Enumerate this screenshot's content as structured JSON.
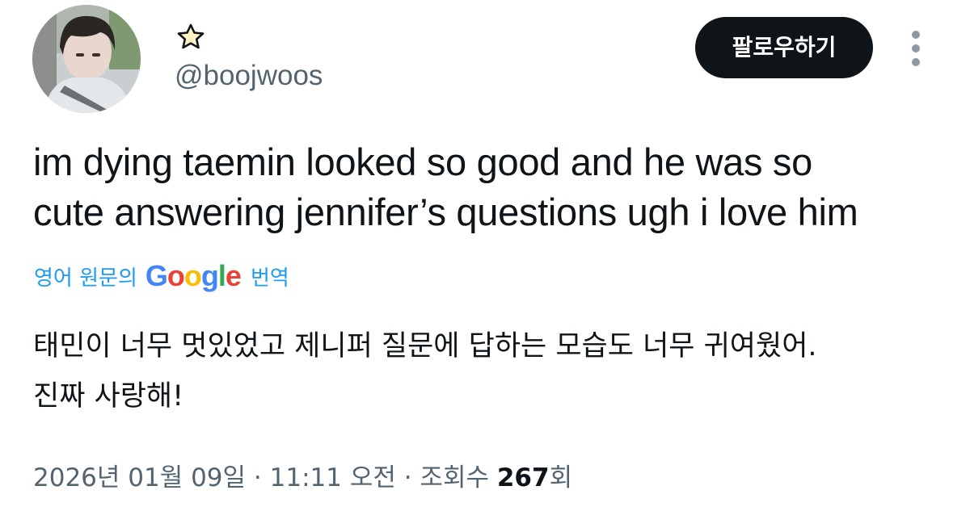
{
  "author": {
    "handle": "@boojwoos",
    "display_name_icon": "star-icon",
    "avatar_alt": "profile photo"
  },
  "follow_button": {
    "label": "팔로우하기"
  },
  "more_icon": "more-vertical-icon",
  "tweet": {
    "text": "im dying taemin looked so good  and he was so\ncute answering jennifer’s questions ugh i love him"
  },
  "translation": {
    "label_prefix": "영어 원문의",
    "provider": "Google",
    "label_suffix": "번역",
    "text": "태민이 너무 멋있었고 제니퍼 질문에 답하는 모습도 너무 귀여웠어.\n진짜 사랑해!"
  },
  "meta": {
    "date": "2026년 01월 09일",
    "separator": " · ",
    "time": "11:11 오전",
    "views_label": "조회수",
    "views_count": "267",
    "views_suffix": "회"
  },
  "colors": {
    "text_primary": "#0f1419",
    "text_secondary": "#536471",
    "link_blue": "#1d9bf0",
    "button_bg": "#0f1419",
    "google_blue": "#4285f4",
    "google_red": "#ea4335",
    "google_yellow": "#fbbc05",
    "google_green": "#34a853"
  }
}
